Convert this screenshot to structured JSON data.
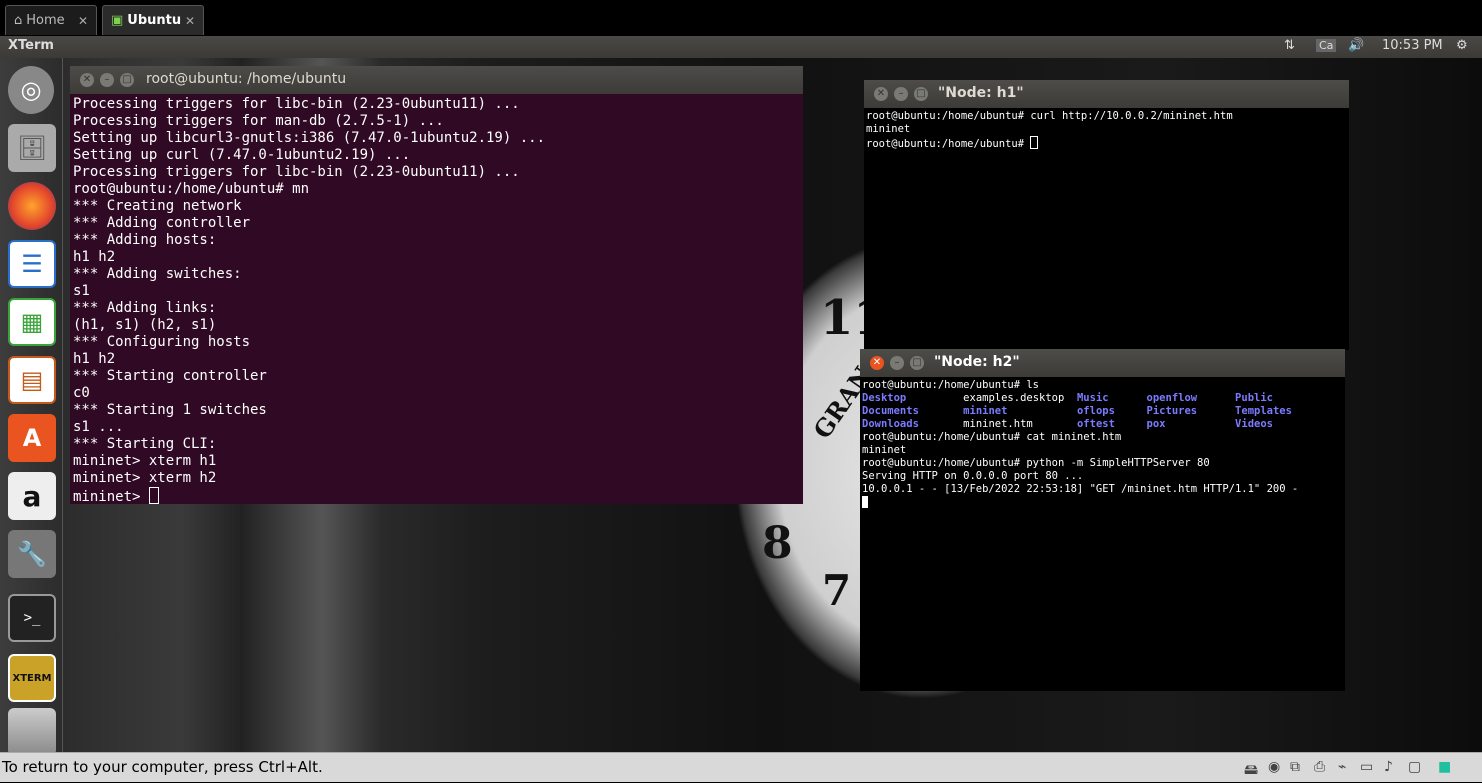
{
  "vm_tabs": [
    {
      "label": "Home",
      "icon": "home-icon"
    },
    {
      "label": "Ubuntu",
      "icon": "vm-icon",
      "active": true
    }
  ],
  "panel": {
    "app_title": "XTerm",
    "keyboard": "Ca",
    "time": "10:53 PM"
  },
  "launcher": [
    "ubuntu-dash",
    "files",
    "firefox",
    "libreoffice-writer",
    "libreoffice-calc",
    "libreoffice-impress",
    "software-center",
    "amazon",
    "system-settings",
    "terminal",
    "xterm",
    "trash"
  ],
  "main_terminal": {
    "title": "root@ubuntu: /home/ubuntu",
    "lines": [
      "Processing triggers for libc-bin (2.23-0ubuntu11) ...",
      "Processing triggers for man-db (2.7.5-1) ...",
      "Setting up libcurl3-gnutls:i386 (7.47.0-1ubuntu2.19) ...",
      "Setting up curl (7.47.0-1ubuntu2.19) ...",
      "Processing triggers for libc-bin (2.23-0ubuntu11) ...",
      "root@ubuntu:/home/ubuntu# mn",
      "*** Creating network",
      "*** Adding controller",
      "*** Adding hosts:",
      "h1 h2",
      "*** Adding switches:",
      "s1",
      "*** Adding links:",
      "(h1, s1) (h2, s1)",
      "*** Configuring hosts",
      "h1 h2",
      "*** Starting controller",
      "c0",
      "*** Starting 1 switches",
      "s1 ...",
      "*** Starting CLI:",
      "mininet> xterm h1",
      "mininet> xterm h2"
    ],
    "prompt": "mininet> "
  },
  "node_h1": {
    "title": "\"Node: h1\"",
    "lines": [
      "root@ubuntu:/home/ubuntu# curl http://10.0.0.2/mininet.htm",
      "mininet"
    ],
    "prompt": "root@ubuntu:/home/ubuntu# "
  },
  "node_h2": {
    "title": "\"Node: h2\"",
    "cmd_ls": "root@ubuntu:/home/ubuntu# ls",
    "ls_rows": [
      [
        {
          "t": "Desktop",
          "d": true
        },
        {
          "t": "examples.desktop",
          "d": false
        },
        {
          "t": "Music",
          "d": true
        },
        {
          "t": "openflow",
          "d": true
        },
        {
          "t": "Public",
          "d": true
        }
      ],
      [
        {
          "t": "Documents",
          "d": true
        },
        {
          "t": "mininet",
          "d": true
        },
        {
          "t": "oflops",
          "d": true
        },
        {
          "t": "Pictures",
          "d": true
        },
        {
          "t": "Templates",
          "d": true
        }
      ],
      [
        {
          "t": "Downloads",
          "d": true
        },
        {
          "t": "mininet.htm",
          "d": false
        },
        {
          "t": "oftest",
          "d": true
        },
        {
          "t": "pox",
          "d": true
        },
        {
          "t": "Videos",
          "d": true
        }
      ]
    ],
    "lines_after": [
      "root@ubuntu:/home/ubuntu# cat mininet.htm",
      "mininet",
      "root@ubuntu:/home/ubuntu# python -m SimpleHTTPServer 80",
      "Serving HTTP on 0.0.0.0 port 80 ...",
      "10.0.0.1 - - [13/Feb/2022 22:53:18] \"GET /mininet.htm HTTP/1.1\" 200 -"
    ]
  },
  "clock_numerals": [
    "11",
    "8",
    "7",
    "GRAN"
  ],
  "statusbar": {
    "message": "To return to your computer, press Ctrl+Alt."
  }
}
